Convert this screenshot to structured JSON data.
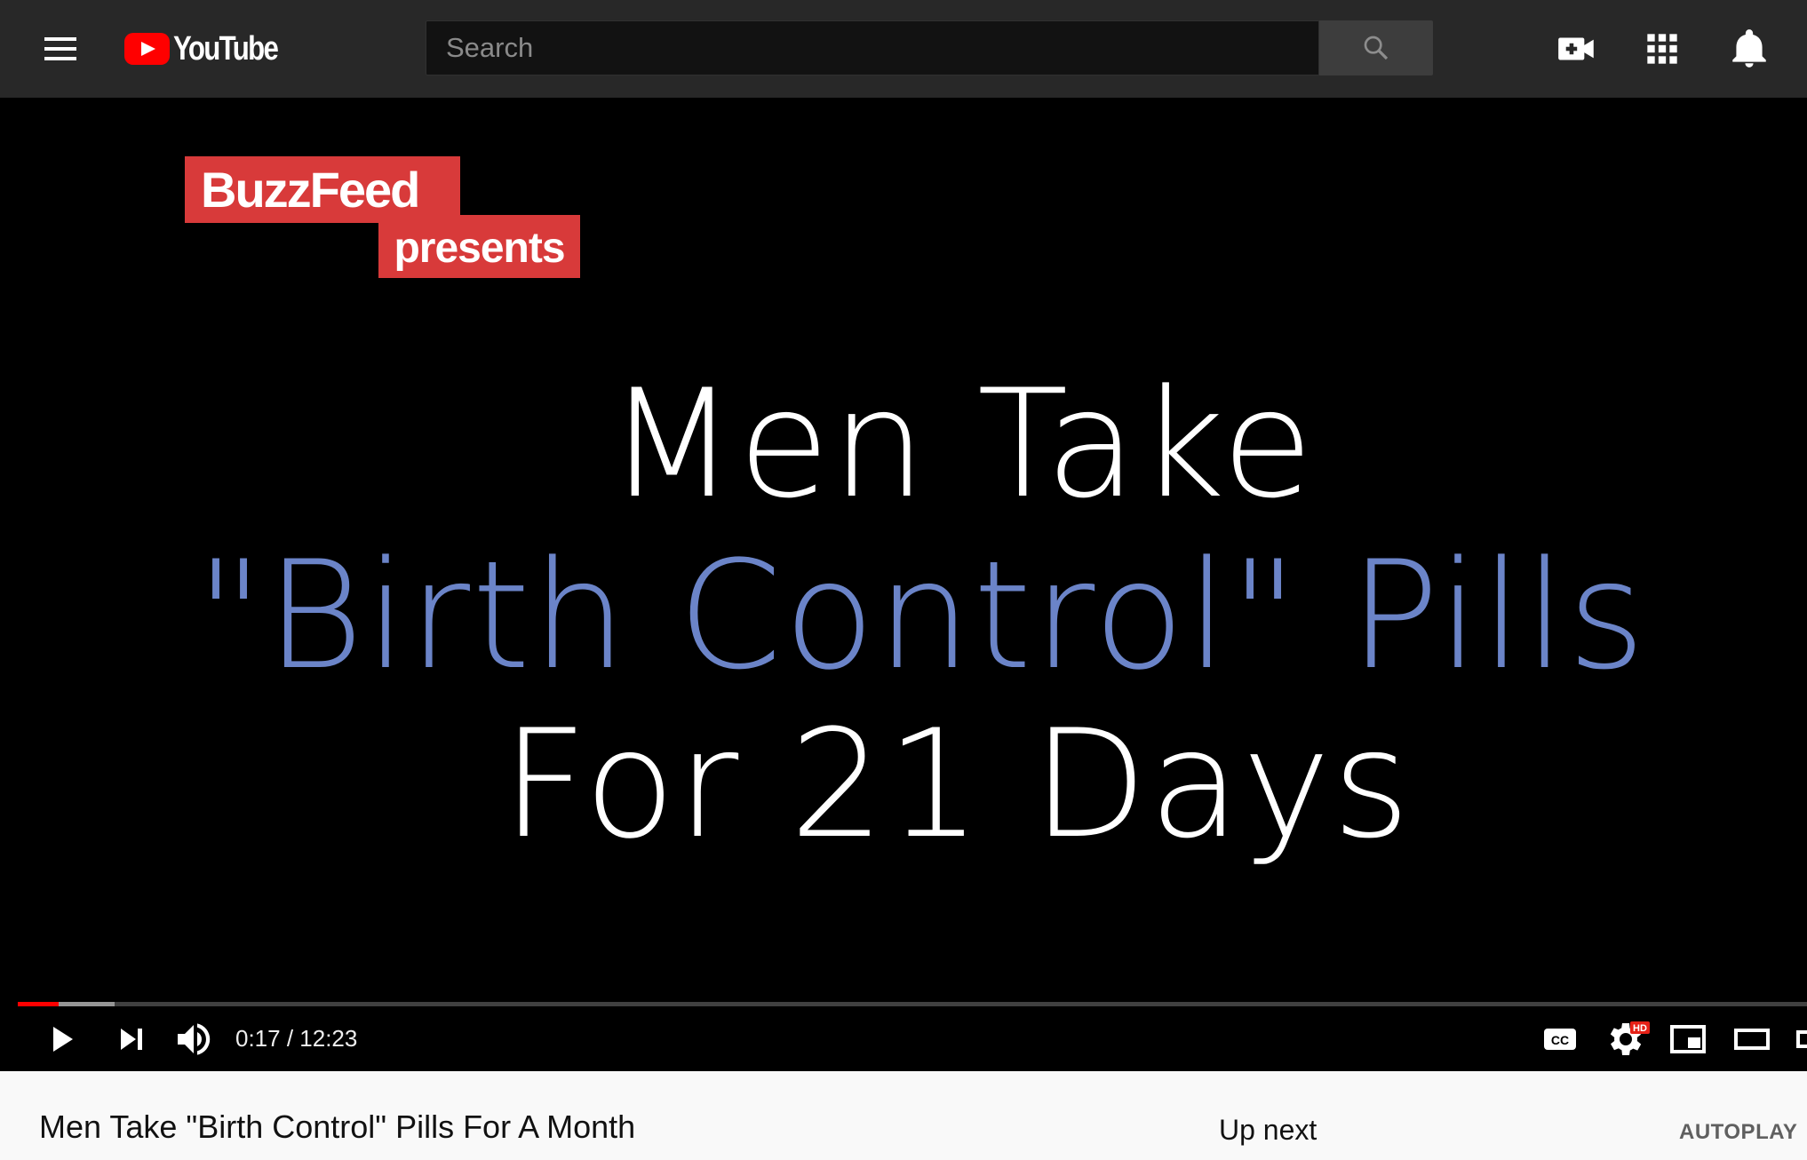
{
  "masthead": {
    "logo_text": "YouTube",
    "search_placeholder": "Search",
    "icons": [
      "menu-icon",
      "youtube-logo-icon",
      "search-icon",
      "video-create-icon",
      "apps-grid-icon",
      "notifications-bell-icon"
    ]
  },
  "player": {
    "frame": {
      "brand_top": "BuzzFeed",
      "brand_bottom": "presents",
      "title_line_1": "Men Take",
      "title_line_2": "\"Birth Control\" Pills",
      "title_line_3": "For 21 Days"
    },
    "time_display": "0:17 / 12:23",
    "progress_played": 0.023,
    "progress_buffered": 0.054,
    "controls": [
      "play-icon",
      "next-icon",
      "volume-icon",
      "captions-icon",
      "settings-icon",
      "miniplayer-icon",
      "theater-icon",
      "fullscreen-icon"
    ],
    "settings_badge": "HD",
    "captions_label": "CC",
    "colors": {
      "accent": "#ff0000",
      "brand_red": "#d83a3a",
      "title_blue": "#6b84c8"
    }
  },
  "below": {
    "video_title": "Men Take \"Birth Control\" Pills For A Month",
    "up_next": "Up next",
    "autoplay": "AUTOPLAY"
  }
}
